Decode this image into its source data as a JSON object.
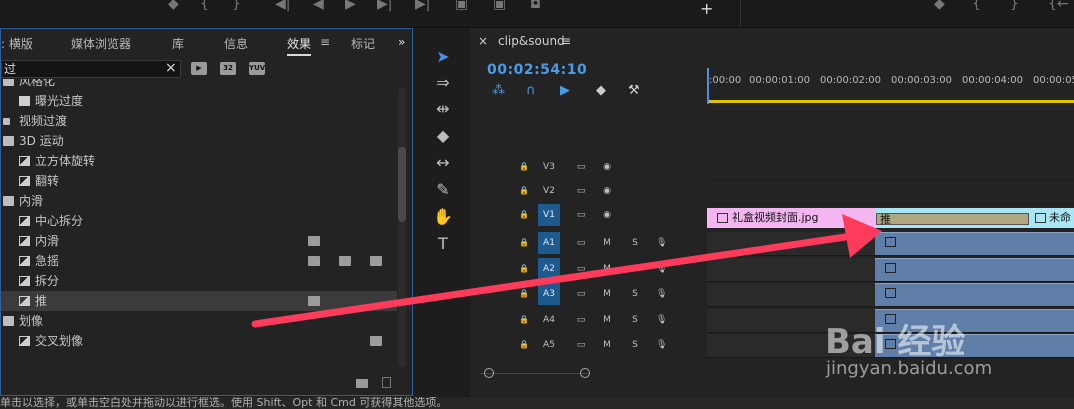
{
  "top_toolbar": {
    "plus_icon": "+",
    "marker_icons": [
      "marker-icon",
      "in-point-icon",
      "out-point-icon"
    ]
  },
  "effects_panel": {
    "tabs": [
      ": 横版",
      "媒体浏览器",
      "库",
      "信息",
      "效果",
      "标记"
    ],
    "active_tab_index": 4,
    "overflow_label": "»",
    "search_value": "过",
    "filter_badges": [
      "32",
      "YUV"
    ],
    "tree": [
      {
        "label": "风格化",
        "type": "folder",
        "indent": 0
      },
      {
        "label": "曝光过度",
        "type": "preset",
        "indent": 1
      },
      {
        "label": "视频过渡",
        "type": "bin",
        "indent": 0
      },
      {
        "label": "3D 运动",
        "type": "folder",
        "indent": 0
      },
      {
        "label": "立方体旋转",
        "type": "effect",
        "indent": 1
      },
      {
        "label": "翻转",
        "type": "effect",
        "indent": 1
      },
      {
        "label": "内滑",
        "type": "folder",
        "indent": 0
      },
      {
        "label": "中心拆分",
        "type": "effect",
        "indent": 1
      },
      {
        "label": "内滑",
        "type": "effect",
        "indent": 1,
        "badges": [
          1
        ]
      },
      {
        "label": "急摇",
        "type": "effect",
        "indent": 1,
        "badges": [
          1,
          2,
          3
        ]
      },
      {
        "label": "拆分",
        "type": "effect",
        "indent": 1
      },
      {
        "label": "推",
        "type": "effect",
        "indent": 1,
        "selected": true,
        "badges": [
          1
        ]
      },
      {
        "label": "划像",
        "type": "folder",
        "indent": 0
      },
      {
        "label": "交叉划像",
        "type": "effect",
        "indent": 1,
        "badges": [
          3
        ]
      }
    ]
  },
  "tools": [
    "selection-tool",
    "track-select-tool",
    "ripple-edit-tool",
    "razor-tool",
    "slip-tool",
    "pen-tool",
    "hand-tool",
    "type-tool"
  ],
  "timeline": {
    "sequence_tab": "clip&sound",
    "close_label": "×",
    "menu_label": "≡",
    "timecode": "00:02:54:10",
    "ruler_ticks": [
      ":00:00",
      "00:00:01:00",
      "00:00:02:00",
      "00:00:03:00",
      "00:00:04:00",
      "00:00:05"
    ],
    "video_tracks": [
      {
        "name": "V3",
        "targeted": false
      },
      {
        "name": "V2",
        "targeted": false
      },
      {
        "name": "V1",
        "targeted": true
      }
    ],
    "audio_tracks": [
      {
        "name": "A1",
        "targeted": true,
        "m": "M",
        "s": "S"
      },
      {
        "name": "A2",
        "targeted": true,
        "m": "M",
        "s": "S"
      },
      {
        "name": "A3",
        "targeted": true,
        "m": "M",
        "s": "S"
      },
      {
        "name": "A4",
        "targeted": false,
        "m": "M",
        "s": "S"
      },
      {
        "name": "A5",
        "targeted": false,
        "m": "M",
        "s": "S"
      }
    ],
    "clips": {
      "v1_clip1": "礼盒视频封面.jpg",
      "v1_transition": "推",
      "v1_clip2": "未命"
    }
  },
  "status_bar": {
    "text": "单击以选择，或单击空白处并拖动以进行框选。使用 Shift、Opt 和 Cmd 可获得其他选项。"
  },
  "watermark": {
    "logo": "Bai 经验",
    "url": "jingyan.baidu.com"
  },
  "colors": {
    "accent": "#4a8fe8",
    "clip_pink": "#f3b6f0",
    "clip_cyan": "#a9e6f5",
    "audio_clip": "#5f7fa8",
    "arrow": "#ff3b5c",
    "timecode": "#4a9be8"
  }
}
